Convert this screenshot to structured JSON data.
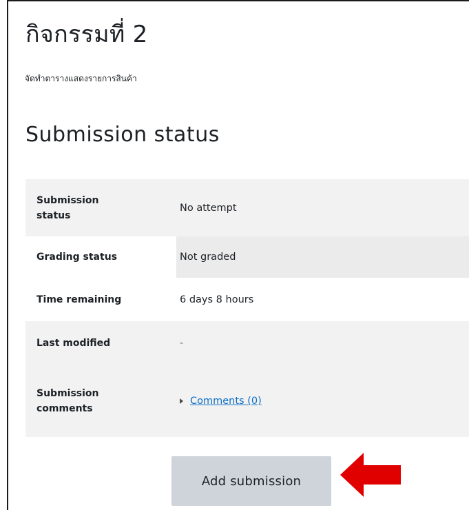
{
  "activity": {
    "title": "กิจกรรมที่ 2",
    "description": "จัดทำตารางแสดงรายการสินค้า"
  },
  "submission_status": {
    "heading": "Submission status",
    "rows": [
      {
        "label": "Submission status",
        "value": "No attempt"
      },
      {
        "label": "Grading status",
        "value": "Not graded"
      },
      {
        "label": "Time remaining",
        "value": "6 days 8 hours"
      },
      {
        "label": "Last modified",
        "value": "-"
      },
      {
        "label": "Submission comments",
        "value": "Comments (0)"
      }
    ]
  },
  "actions": {
    "add_submission_label": "Add submission"
  },
  "colors": {
    "arrow": "#e10000",
    "link": "#0f6fc5",
    "button_bg": "#ced4da"
  },
  "icons": {
    "comments_toggle": "caret-right-icon",
    "pointer": "left-arrow-icon"
  }
}
